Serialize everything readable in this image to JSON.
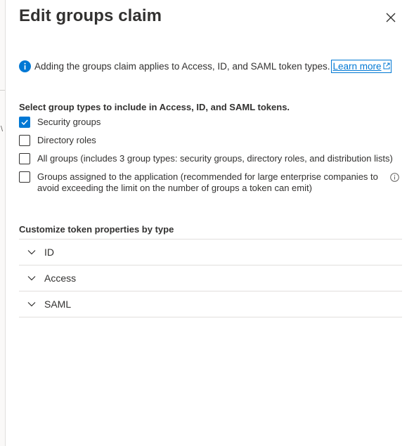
{
  "panel": {
    "title": "Edit groups claim"
  },
  "info": {
    "text": "Adding the groups claim applies to Access, ID, and SAML token types.",
    "link_label": "Learn more"
  },
  "group_types": {
    "heading": "Select group types to include in Access, ID, and SAML tokens.",
    "options": [
      {
        "label": "Security groups",
        "checked": true
      },
      {
        "label": "Directory roles",
        "checked": false
      },
      {
        "label": "All groups (includes 3 group types: security groups, directory roles, and distribution lists)",
        "checked": false
      },
      {
        "label": "Groups assigned to the application (recommended for large enterprise companies to avoid exceeding the limit on the number of groups a token can emit)",
        "checked": false
      }
    ]
  },
  "token_properties": {
    "heading": "Customize token properties by type",
    "sections": [
      {
        "label": "ID"
      },
      {
        "label": "Access"
      },
      {
        "label": "SAML"
      }
    ]
  },
  "colors": {
    "accent": "#0078d4",
    "text": "#323130",
    "border": "#e1dfdd"
  }
}
